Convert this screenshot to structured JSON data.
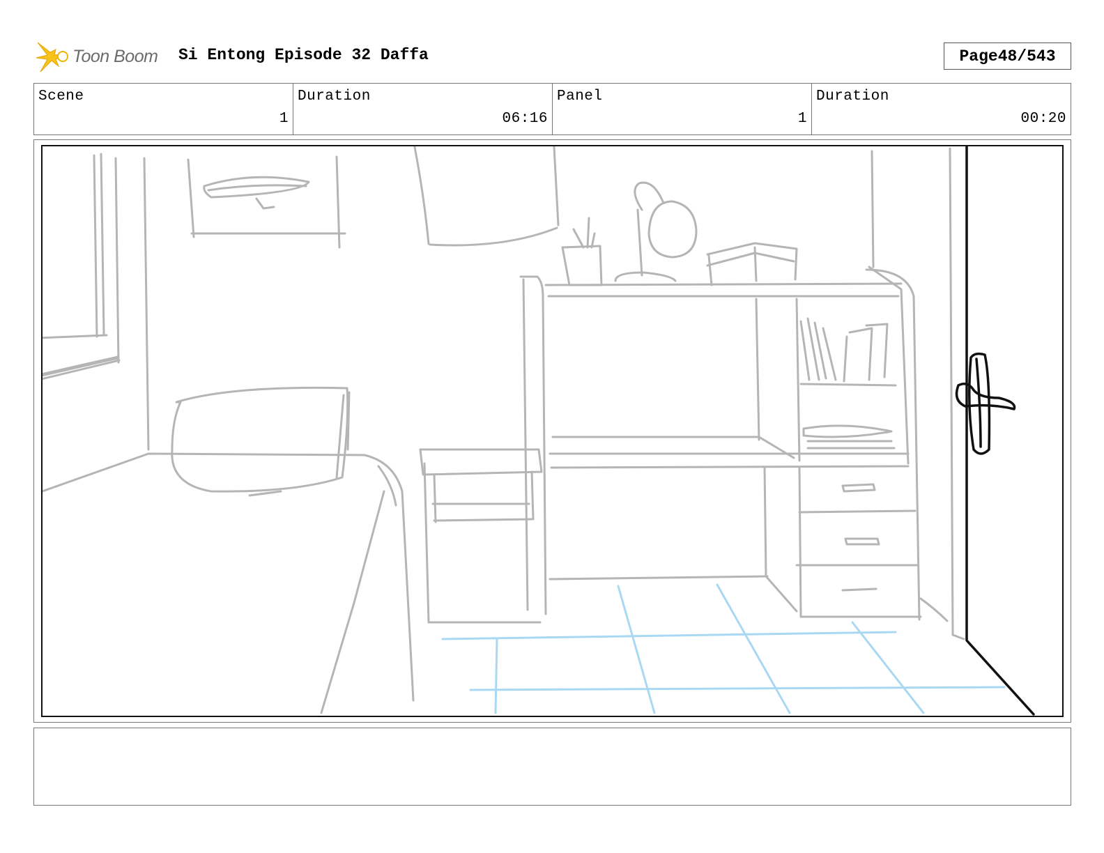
{
  "header": {
    "logo_text": "Toon Boom",
    "title": "Si Entong Episode 32 Daffa",
    "page_label": "Page",
    "page_value": "48/543"
  },
  "info": {
    "scene_label": "Scene",
    "scene_value": "1",
    "scene_duration_label": "Duration",
    "scene_duration_value": "06:16",
    "panel_label": "Panel",
    "panel_value": "1",
    "panel_duration_label": "Duration",
    "panel_duration_value": "00:20"
  },
  "notes": {
    "text": ""
  },
  "colors": {
    "sketch_gray": "#b5b5b5",
    "floor_blue": "#a9d8f2",
    "ink_black": "#111111",
    "logo_yellow": "#f7c21a"
  }
}
